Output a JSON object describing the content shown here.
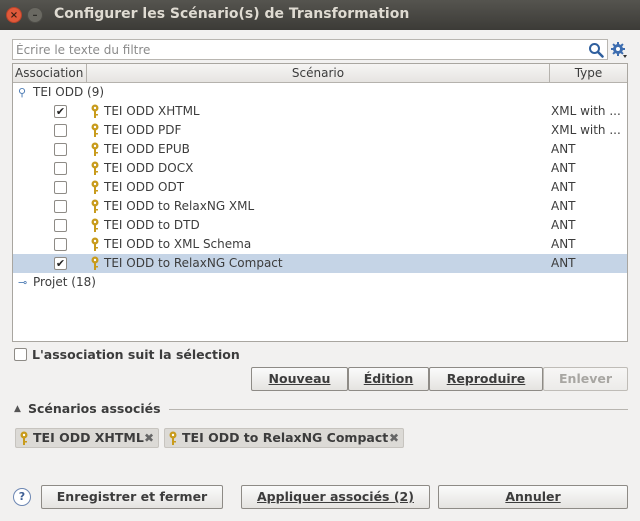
{
  "window": {
    "title": "Configurer les Scénario(s) de Transformation",
    "close_glyph": "×",
    "minimize_glyph": "–"
  },
  "filter": {
    "placeholder": "Écrire le texte du filtre",
    "value": ""
  },
  "table": {
    "headers": {
      "association": "Association",
      "scenario": "Scénario",
      "type": "Type"
    },
    "groups": [
      {
        "label": "TEI ODD (9)",
        "expanded": true
      },
      {
        "label": "Projet (18)",
        "expanded": false
      }
    ],
    "rows": [
      {
        "checked": "✔",
        "name": "TEI ODD XHTML",
        "type": "XML with ..."
      },
      {
        "checked": "",
        "name": "TEI ODD PDF",
        "type": "XML with ..."
      },
      {
        "checked": "",
        "name": "TEI ODD EPUB",
        "type": "ANT"
      },
      {
        "checked": "",
        "name": "TEI ODD DOCX",
        "type": "ANT"
      },
      {
        "checked": "",
        "name": "TEI ODD ODT",
        "type": "ANT"
      },
      {
        "checked": "",
        "name": "TEI ODD to RelaxNG XML",
        "type": "ANT"
      },
      {
        "checked": "",
        "name": "TEI ODD to DTD",
        "type": "ANT"
      },
      {
        "checked": "",
        "name": "TEI ODD to XML Schema",
        "type": "ANT"
      },
      {
        "checked": "✔",
        "name": "TEI ODD to RelaxNG Compact",
        "type": "ANT",
        "selected": true
      }
    ]
  },
  "follow_selection": {
    "label": "L'association suit la sélection",
    "checked": false
  },
  "actions": {
    "new": "Nouveau",
    "edit": "Édition",
    "duplicate": "Reproduire",
    "remove": "Enlever"
  },
  "associated": {
    "title": "Scénarios associés",
    "items": [
      {
        "label": "TEI ODD XHTML",
        "remove": "✖"
      },
      {
        "label": "TEI ODD to RelaxNG Compact",
        "remove": "✖"
      }
    ]
  },
  "footer": {
    "help": "?",
    "save_close": "Enregistrer et fermer",
    "apply": "Appliquer associés (2)",
    "cancel": "Annuler"
  },
  "colors": {
    "selection": "#c5d4e6",
    "titlebar": "#3c3b37",
    "close": "#e0593a",
    "key": "#c89b1c"
  }
}
